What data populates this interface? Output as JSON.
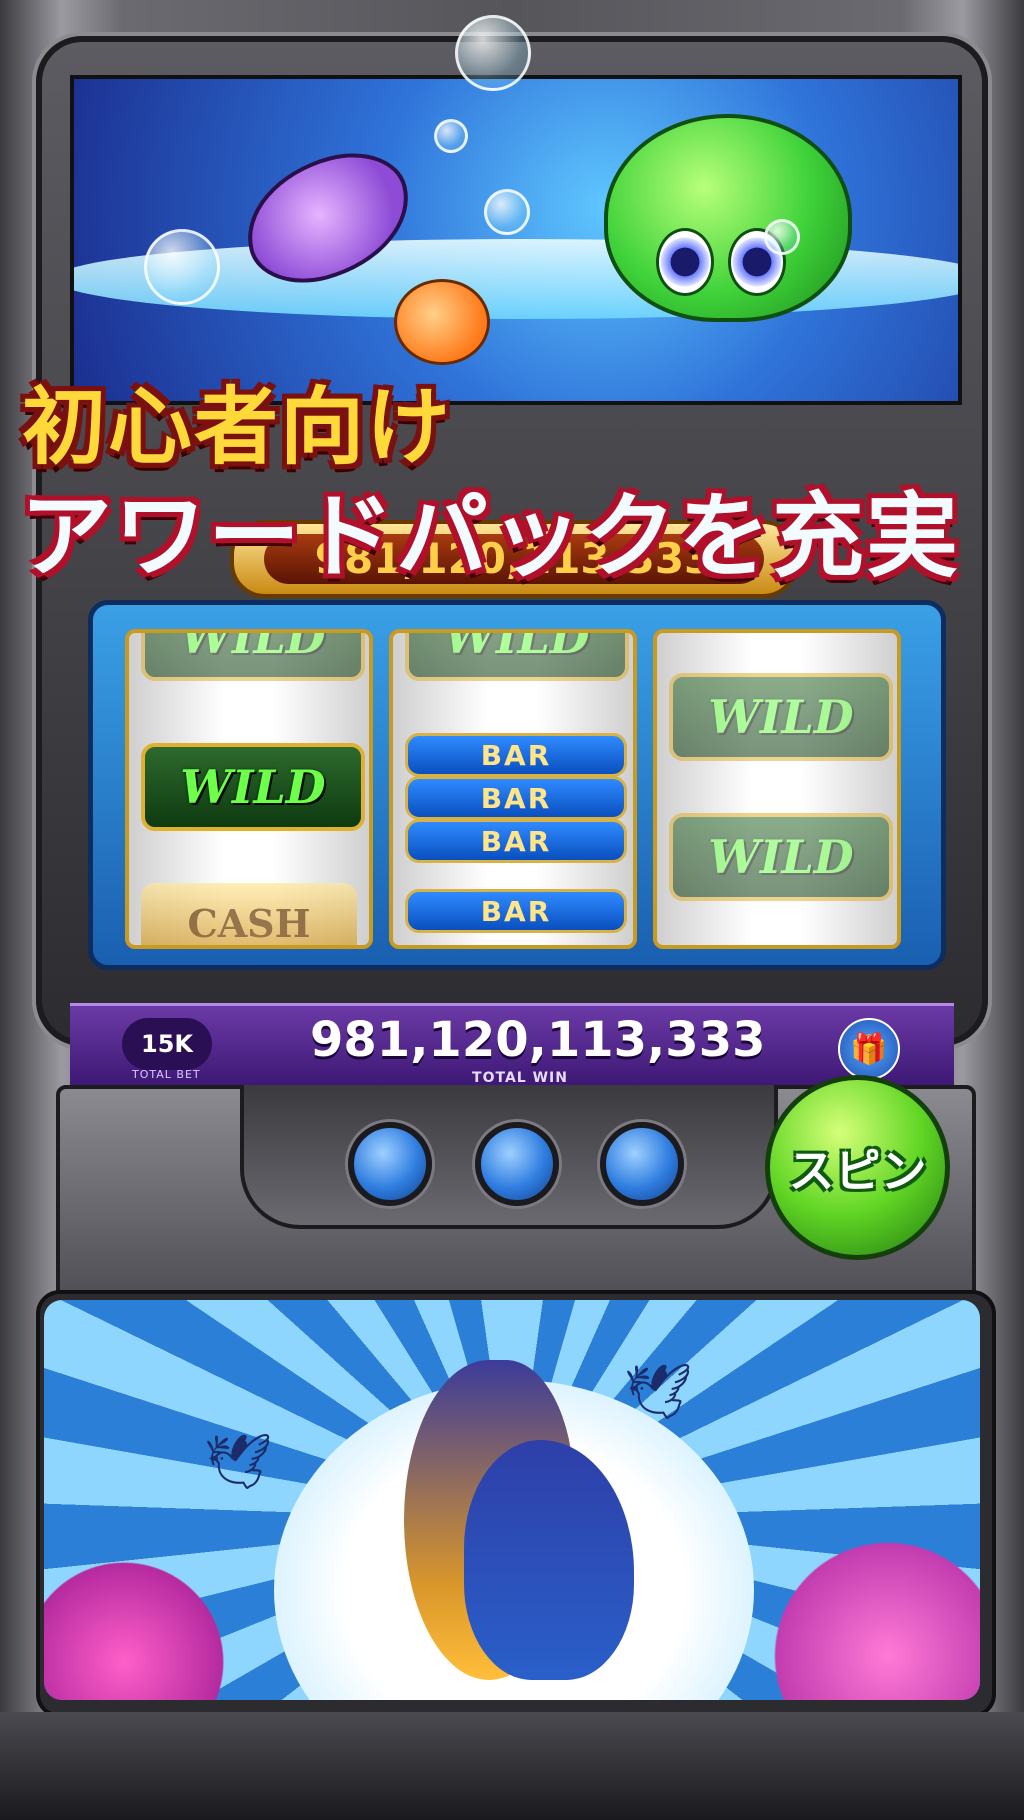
{
  "promo": {
    "line1": "初心者向け",
    "line2": "アワードパックを充実"
  },
  "jackpot": {
    "value": "981,120,113,333"
  },
  "reels": [
    {
      "symbols": [
        "WILD",
        "WILD",
        "CASH"
      ]
    },
    {
      "symbols": [
        "WILD",
        "BAR",
        "BAR",
        "BAR",
        "BAR"
      ]
    },
    {
      "symbols": [
        "WILD",
        "WILD"
      ]
    }
  ],
  "info_bar": {
    "total_bet_value": "15K",
    "total_bet_label": "TOTAL BET",
    "total_win_value": "981,120,113,333",
    "total_win_label": "TOTAL WIN",
    "gift_icon": "gift-icon"
  },
  "controls": {
    "spin_label": "スピン"
  },
  "colors": {
    "accent_purple": "#3d1874",
    "spin_green": "#62d625",
    "headline_yellow": "#ffd93a"
  }
}
